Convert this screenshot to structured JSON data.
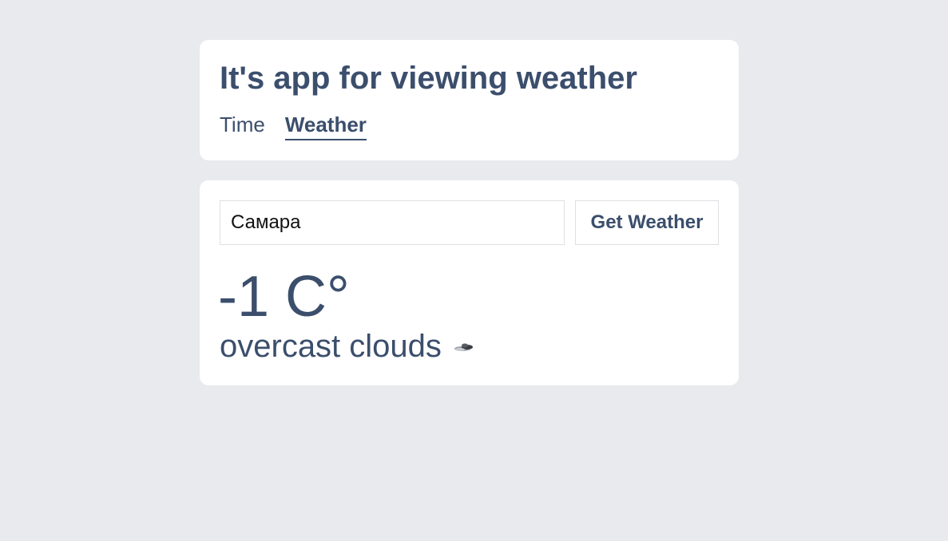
{
  "header": {
    "title": "It's app for viewing weather",
    "tabs": [
      {
        "label": "Time",
        "active": false
      },
      {
        "label": "Weather",
        "active": true
      }
    ]
  },
  "weather": {
    "city_input": {
      "value": "Самара"
    },
    "button_label": "Get Weather",
    "temperature": "-1 C°",
    "description": "overcast clouds",
    "icon": "overcast-clouds-icon"
  },
  "colors": {
    "background": "#e9eaee",
    "card": "#ffffff",
    "text": "#3b4e6c",
    "border": "#dfe0e4"
  }
}
